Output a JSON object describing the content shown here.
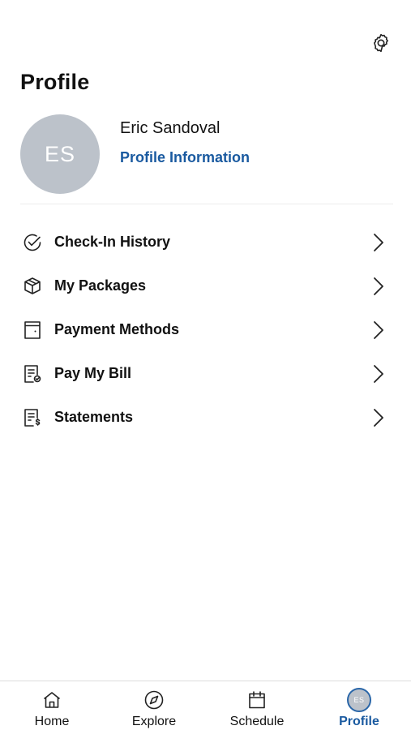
{
  "header": {
    "title": "Profile",
    "settings_icon": "gear-icon"
  },
  "user": {
    "initials": "ES",
    "name": "Eric Sandoval",
    "profile_link": "Profile Information"
  },
  "menu": [
    {
      "label": "Check-In History",
      "icon": "check-circle-icon"
    },
    {
      "label": "My Packages",
      "icon": "package-icon"
    },
    {
      "label": "Payment Methods",
      "icon": "wallet-icon"
    },
    {
      "label": "Pay My Bill",
      "icon": "bill-check-icon"
    },
    {
      "label": "Statements",
      "icon": "statement-dollar-icon"
    }
  ],
  "tabs": [
    {
      "label": "Home",
      "icon": "home-icon"
    },
    {
      "label": "Explore",
      "icon": "compass-icon"
    },
    {
      "label": "Schedule",
      "icon": "calendar-icon"
    },
    {
      "label": "Profile",
      "icon": "avatar",
      "initials": "ES",
      "active": true
    }
  ],
  "colors": {
    "accent": "#1a5aa0",
    "avatar_bg": "#bcc2ca"
  }
}
